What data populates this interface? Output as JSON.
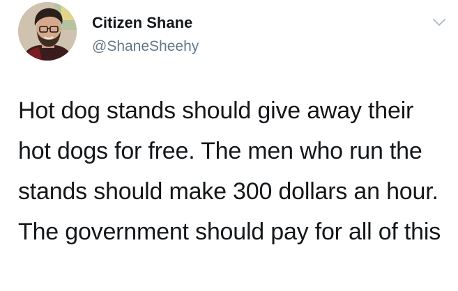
{
  "author": {
    "display_name": "Citizen Shane",
    "handle": "@ShaneSheehy"
  },
  "icons": {
    "menu": "chevron-down-icon"
  },
  "tweet": {
    "text": "Hot dog stands should give away their hot dogs for free. The men who run the stands should make 300 dollars an hour. The government should pay for all of this"
  },
  "colors": {
    "text": "#14171a",
    "secondary": "#657786",
    "chevron": "#aab8c2"
  }
}
